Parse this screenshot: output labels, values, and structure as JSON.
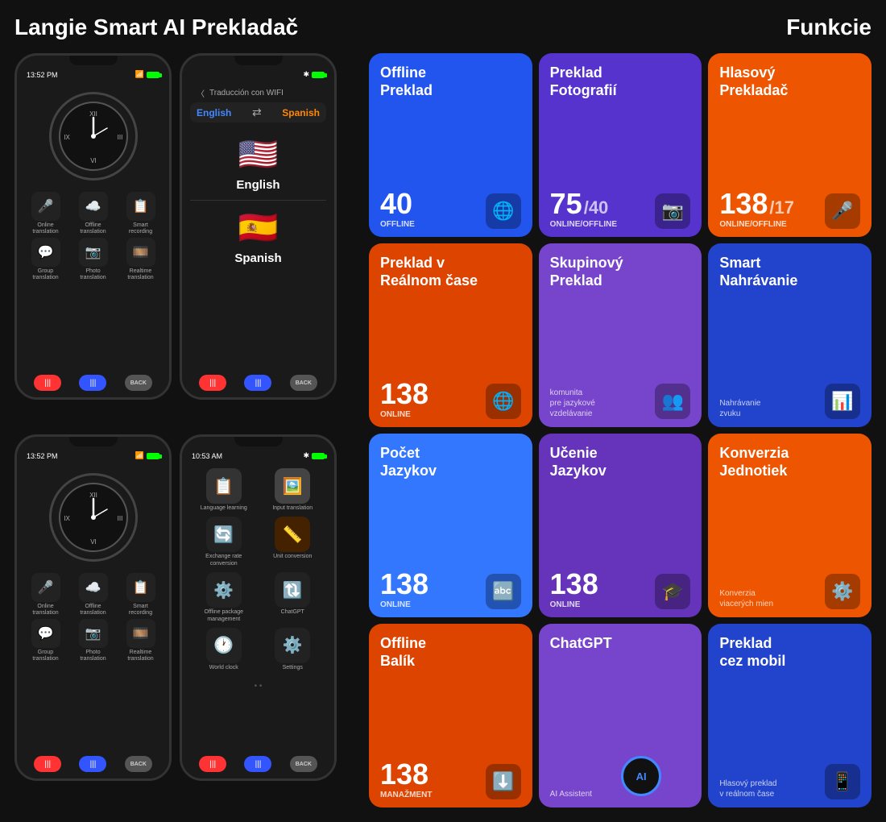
{
  "header": {
    "title": "Langie Smart AI Prekladač",
    "subtitle": "Funkcie"
  },
  "phone1_top": {
    "time": "13:52 PM",
    "icons": [
      {
        "label": "Online\ntranslation",
        "emoji": "🎤"
      },
      {
        "label": "Offline\ntranslation",
        "emoji": "☁️"
      },
      {
        "label": "Smart\nrecording",
        "emoji": "📋"
      },
      {
        "label": "Group\ntranslation",
        "emoji": "💬"
      },
      {
        "label": "Photo\ntranslation",
        "emoji": "📷"
      },
      {
        "label": "Realtime\ntranslation",
        "emoji": "🎞️"
      }
    ]
  },
  "phone2_top": {
    "header": "Traducción con WIFI",
    "lang_from": "English",
    "lang_to": "Spanish",
    "flag_from": "🇺🇸",
    "flag_to": "🇪🇸"
  },
  "phone1_bottom": {
    "time": "13:52 PM"
  },
  "phone2_bottom": {
    "time": "10:53 AM",
    "menu_items": [
      {
        "label": "Language learning",
        "emoji": "📋"
      },
      {
        "label": "Input translation",
        "emoji": "🖼️"
      },
      {
        "label": "Exchange rate\nconversion",
        "emoji": "🔄"
      },
      {
        "label": "Unit conversion",
        "emoji": "📏"
      },
      {
        "label": "Offline package\nmanagement",
        "emoji": "⚙️"
      },
      {
        "label": "ChatGPT",
        "emoji": "🔃"
      },
      {
        "label": "World clock",
        "emoji": "🕐"
      },
      {
        "label": "Settings",
        "emoji": "⚙️"
      }
    ]
  },
  "features": [
    {
      "title": "Offline\nPreklad",
      "count": "40",
      "count_suffix": "",
      "label": "OFFLINE",
      "sublabel": "",
      "icon": "🌐",
      "color": "blue"
    },
    {
      "title": "Preklad\nFotografií",
      "count": "75",
      "count_suffix": "/40",
      "label": "ONLINE/OFFLINE",
      "sublabel": "",
      "icon": "📷",
      "color": "purple"
    },
    {
      "title": "Hlasový\nPrekladač",
      "count": "138",
      "count_suffix": "/17",
      "label": "ONLINE/OFFLINE",
      "sublabel": "",
      "icon": "🎤",
      "color": "orange"
    },
    {
      "title": "Preklad v\nReálnom čase",
      "count": "138",
      "count_suffix": "",
      "label": "ONLINE",
      "sublabel": "",
      "icon": "🌐",
      "color": "orange2"
    },
    {
      "title": "Skupinový\nPreklad",
      "count": "",
      "count_suffix": "",
      "label": "",
      "sublabel": "komunita\npre jazykové\nvzdelávanie",
      "icon": "👥",
      "color": "purple2"
    },
    {
      "title": "Smart\nNahrávanie",
      "count": "",
      "count_suffix": "",
      "label": "",
      "sublabel": "Nahrávanie\nzvuku",
      "icon": "📊",
      "color": "blue3"
    },
    {
      "title": "Počet\nJazykov",
      "count": "138",
      "count_suffix": "",
      "label": "ONLINE",
      "sublabel": "",
      "icon": "🔤",
      "color": "blue2"
    },
    {
      "title": "Učenie\nJazykov",
      "count": "138",
      "count_suffix": "",
      "label": "ONLINE",
      "sublabel": "",
      "icon": "🎓",
      "color": "purple3"
    },
    {
      "title": "Konverzia\nJednotiek",
      "count": "",
      "count_suffix": "",
      "label": "",
      "sublabel": "Konverzia\nviacerých mien",
      "icon": "⚙️",
      "color": "orange"
    },
    {
      "title": "Offline\nBalík",
      "count": "138",
      "count_suffix": "",
      "label": "MANAŽMENT",
      "sublabel": "",
      "icon": "⬇️",
      "color": "orange2"
    },
    {
      "title": "ChatGPT",
      "count": "",
      "count_suffix": "",
      "label": "",
      "sublabel": "AI Assistent",
      "icon": "ai",
      "color": "purple2"
    },
    {
      "title": "Preklad\ncez mobil",
      "count": "",
      "count_suffix": "",
      "label": "",
      "sublabel": "Hlasový preklad\nv reálnom čase",
      "icon": "📱",
      "color": "blue3"
    }
  ],
  "bottom_buttons": {
    "red": "|||",
    "blue": "|||",
    "back": "BACK"
  }
}
